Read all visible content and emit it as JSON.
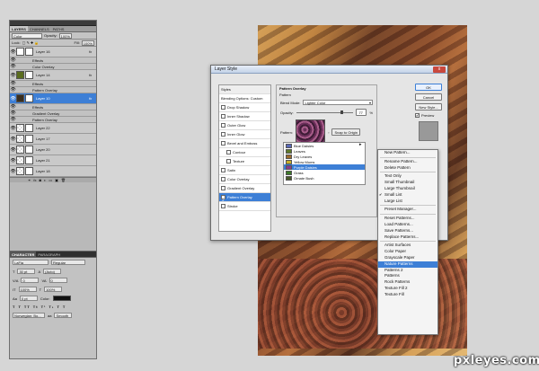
{
  "layers_panel": {
    "tabs": [
      "LAYERS",
      "CHANNELS",
      "PATHS"
    ],
    "blend_mode": "Color",
    "opacity_label": "Opacity:",
    "opacity_value": "100%",
    "lock_label": "Lock:",
    "fill_label": "Fill:",
    "fill_value": "100%",
    "rows": [
      {
        "type": "layer",
        "name": "Layer 16",
        "thumb": "fig",
        "fx": "fx"
      },
      {
        "type": "effect",
        "name": "Effects"
      },
      {
        "type": "effect",
        "name": "Color Overlay"
      },
      {
        "type": "layer",
        "name": "Layer 14",
        "thumb": "green",
        "fx": "fx"
      },
      {
        "type": "effect",
        "name": "Effects"
      },
      {
        "type": "effect",
        "name": "Pattern Overlay"
      },
      {
        "type": "layer",
        "name": "Layer 10",
        "thumb": "dark",
        "fx": "fx",
        "selected": true
      },
      {
        "type": "effect",
        "name": "Effects"
      },
      {
        "type": "effect",
        "name": "Gradient Overlay"
      },
      {
        "type": "effect",
        "name": "Pattern Overlay"
      },
      {
        "type": "layer",
        "name": "Layer 22",
        "thumb": "trans",
        "fx": ""
      },
      {
        "type": "layer",
        "name": "Layer 17",
        "thumb": "trans",
        "fx": ""
      },
      {
        "type": "layer",
        "name": "Layer 20",
        "thumb": "trans",
        "fx": ""
      },
      {
        "type": "layer",
        "name": "Layer 21",
        "thumb": "trans",
        "fx": ""
      },
      {
        "type": "layer",
        "name": "Layer 18",
        "thumb": "trans",
        "fx": ""
      }
    ]
  },
  "character_panel": {
    "tabs": [
      "CHARACTER",
      "PARAGRAPH"
    ],
    "font": "LaFia",
    "style": "Regular",
    "size": "30 pt",
    "leading": "(Auto)",
    "tracking": "0",
    "kerning": "0",
    "scale_v": "100%",
    "scale_h": "100%",
    "baseline": "0 pt",
    "color_label": "Color:",
    "language": "Norwegian: Bo...",
    "aa_label": "aa",
    "aa_value": "Smooth"
  },
  "dialog": {
    "title": "Layer Style",
    "close": "x",
    "list_header": "Styles",
    "list_items": [
      {
        "label": "Blending Options: Custom",
        "checkbox": false
      },
      {
        "label": "Drop Shadow",
        "checkbox": true
      },
      {
        "label": "Inner Shadow",
        "checkbox": true
      },
      {
        "label": "Outer Glow",
        "checkbox": true
      },
      {
        "label": "Inner Glow",
        "checkbox": true
      },
      {
        "label": "Bevel and Emboss",
        "checkbox": true
      },
      {
        "label": "Contour",
        "checkbox": true,
        "indent": true
      },
      {
        "label": "Texture",
        "checkbox": true,
        "indent": true
      },
      {
        "label": "Satin",
        "checkbox": true
      },
      {
        "label": "Color Overlay",
        "checkbox": true
      },
      {
        "label": "Gradient Overlay",
        "checkbox": true
      },
      {
        "label": "Pattern Overlay",
        "checkbox": true,
        "selected": true
      },
      {
        "label": "Stroke",
        "checkbox": true
      }
    ],
    "group_title": "Pattern Overlay",
    "sub_title": "Pattern",
    "blend_label": "Blend Mode:",
    "blend_value": "Lighter Color",
    "opacity_label": "Opacity:",
    "opacity_value": "77",
    "opacity_unit": "%",
    "pattern_label": "Pattern:",
    "snap_button": "Snap to Origin",
    "pattern_items": [
      {
        "name": "Blue Daisies",
        "color": "#5a6ab8"
      },
      {
        "name": "Leaves",
        "color": "#5e7a2a"
      },
      {
        "name": "Dry Leaves",
        "color": "#9a6a2a"
      },
      {
        "name": "Yellow Mums",
        "color": "#c8b02a"
      },
      {
        "name": "Purple Daisies",
        "color": "#8a3a8a",
        "selected": true
      },
      {
        "name": "Grass",
        "color": "#3e7a2a"
      },
      {
        "name": "Ornate Bush",
        "color": "#4a5a2a"
      }
    ],
    "buttons": [
      "OK",
      "Cancel",
      "New Style..."
    ],
    "preview_label": "Preview"
  },
  "context_menu": {
    "items": [
      {
        "label": "New Pattern..."
      },
      {
        "sep": true
      },
      {
        "label": "Rename Pattern..."
      },
      {
        "label": "Delete Pattern"
      },
      {
        "sep": true
      },
      {
        "label": "Text Only"
      },
      {
        "label": "Small Thumbnail"
      },
      {
        "label": "Large Thumbnail"
      },
      {
        "label": "Small List",
        "checked": true
      },
      {
        "label": "Large List"
      },
      {
        "sep": true
      },
      {
        "label": "Preset Manager..."
      },
      {
        "sep": true
      },
      {
        "label": "Reset Patterns..."
      },
      {
        "label": "Load Patterns..."
      },
      {
        "label": "Save Patterns..."
      },
      {
        "label": "Replace Patterns..."
      },
      {
        "sep": true
      },
      {
        "label": "Artist Surfaces"
      },
      {
        "label": "Color Paper"
      },
      {
        "label": "Grayscale Paper"
      },
      {
        "label": "Nature Patterns",
        "highlighted": true
      },
      {
        "label": "Patterns 2"
      },
      {
        "label": "Patterns"
      },
      {
        "label": "Rock Patterns"
      },
      {
        "label": "Texture Fill 2"
      },
      {
        "label": "Texture Fill"
      }
    ]
  },
  "watermark": "pxleyes.com",
  "colors": {
    "selection": "#3d7fd6",
    "menu_bg": "#f4f4f4"
  }
}
